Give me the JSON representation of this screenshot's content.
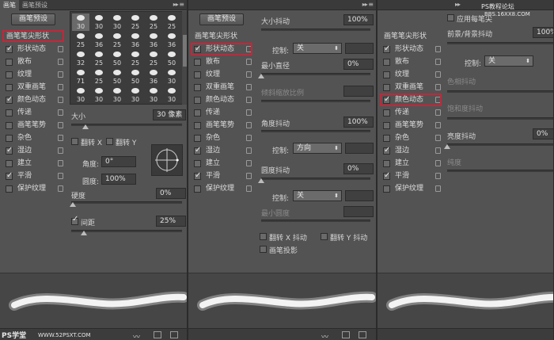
{
  "panel1": {
    "tabs": [
      "画笔",
      "画笔预设"
    ],
    "preset_button": "画笔预设",
    "sidebar": [
      {
        "label": "画笔笔尖形状",
        "checkbox": false,
        "checked": false,
        "lock": false
      },
      {
        "label": "形状动态",
        "checkbox": true,
        "checked": true,
        "lock": true
      },
      {
        "label": "散布",
        "checkbox": true,
        "checked": false,
        "lock": true
      },
      {
        "label": "纹理",
        "checkbox": true,
        "checked": false,
        "lock": true
      },
      {
        "label": "双重画笔",
        "checkbox": true,
        "checked": false,
        "lock": true
      },
      {
        "label": "颜色动态",
        "checkbox": true,
        "checked": true,
        "lock": true
      },
      {
        "label": "传递",
        "checkbox": true,
        "checked": false,
        "lock": true
      },
      {
        "label": "画笔笔势",
        "checkbox": true,
        "checked": false,
        "lock": true
      },
      {
        "label": "杂色",
        "checkbox": true,
        "checked": false,
        "lock": true
      },
      {
        "label": "湿边",
        "checkbox": true,
        "checked": true,
        "lock": true
      },
      {
        "label": "建立",
        "checkbox": true,
        "checked": false,
        "lock": true
      },
      {
        "label": "平滑",
        "checkbox": true,
        "checked": true,
        "lock": true
      },
      {
        "label": "保护纹理",
        "checkbox": true,
        "checked": false,
        "lock": true
      }
    ],
    "brush_tips": [
      [
        "30",
        "30",
        "30",
        "25",
        "25",
        "25"
      ],
      [
        "25",
        "36",
        "25",
        "36",
        "36",
        "36"
      ],
      [
        "32",
        "25",
        "50",
        "25",
        "25",
        "50"
      ],
      [
        "71",
        "25",
        "50",
        "50",
        "36",
        "30"
      ],
      [
        "30",
        "30",
        "30",
        "30",
        "30",
        "30"
      ]
    ],
    "size_label": "大小",
    "size_value": "30 像素",
    "flip_x": "翻转 X",
    "flip_y": "翻转 Y",
    "angle_label": "角度:",
    "angle_value": "0°",
    "roundness_label": "圆度:",
    "roundness_value": "100%",
    "hardness_label": "硬度",
    "hardness_value": "0%",
    "spacing_label": "间距",
    "spacing_value": "25%"
  },
  "panel2": {
    "preset_button": "画笔预设",
    "sidebar": [
      {
        "label": "画笔笔尖形状",
        "checkbox": false,
        "checked": false,
        "lock": false
      },
      {
        "label": "形状动态",
        "checkbox": true,
        "checked": true,
        "lock": true
      },
      {
        "label": "散布",
        "checkbox": true,
        "checked": false,
        "lock": true
      },
      {
        "label": "纹理",
        "checkbox": true,
        "checked": false,
        "lock": true
      },
      {
        "label": "双重画笔",
        "checkbox": true,
        "checked": false,
        "lock": true
      },
      {
        "label": "颜色动态",
        "checkbox": true,
        "checked": false,
        "lock": true
      },
      {
        "label": "传递",
        "checkbox": true,
        "checked": false,
        "lock": true
      },
      {
        "label": "画笔笔势",
        "checkbox": true,
        "checked": false,
        "lock": true
      },
      {
        "label": "杂色",
        "checkbox": true,
        "checked": false,
        "lock": true
      },
      {
        "label": "湿边",
        "checkbox": true,
        "checked": true,
        "lock": true
      },
      {
        "label": "建立",
        "checkbox": true,
        "checked": false,
        "lock": true
      },
      {
        "label": "平滑",
        "checkbox": true,
        "checked": true,
        "lock": true
      },
      {
        "label": "保护纹理",
        "checkbox": true,
        "checked": false,
        "lock": true
      }
    ],
    "size_jitter_label": "大小抖动",
    "size_jitter_value": "100%",
    "control_label": "控制:",
    "control1_value": "关",
    "min_diameter_label": "最小直径",
    "min_diameter_value": "0%",
    "tilt_scale_label": "倾斜缩放比例",
    "angle_jitter_label": "角度抖动",
    "angle_jitter_value": "100%",
    "control2_value": "方向",
    "roundness_jitter_label": "圆度抖动",
    "roundness_jitter_value": "0%",
    "control3_value": "关",
    "min_roundness_label": "最小圆度",
    "flip_x_jitter": "翻转 X 抖动",
    "flip_y_jitter": "翻转 Y 抖动",
    "brush_projection": "画笔投影"
  },
  "panel3": {
    "sidebar": [
      {
        "label": "画笔笔尖形状",
        "checkbox": false,
        "checked": false,
        "lock": false
      },
      {
        "label": "形状动态",
        "checkbox": true,
        "checked": true,
        "lock": true
      },
      {
        "label": "散布",
        "checkbox": true,
        "checked": false,
        "lock": true
      },
      {
        "label": "纹理",
        "checkbox": true,
        "checked": false,
        "lock": true
      },
      {
        "label": "双重画笔",
        "checkbox": true,
        "checked": false,
        "lock": true
      },
      {
        "label": "颜色动态",
        "checkbox": true,
        "checked": true,
        "lock": true
      },
      {
        "label": "传递",
        "checkbox": true,
        "checked": false,
        "lock": true
      },
      {
        "label": "画笔笔势",
        "checkbox": true,
        "checked": false,
        "lock": true
      },
      {
        "label": "杂色",
        "checkbox": true,
        "checked": false,
        "lock": true
      },
      {
        "label": "湿边",
        "checkbox": true,
        "checked": true,
        "lock": true
      },
      {
        "label": "建立",
        "checkbox": true,
        "checked": false,
        "lock": true
      },
      {
        "label": "平滑",
        "checkbox": true,
        "checked": true,
        "lock": true
      },
      {
        "label": "保护纹理",
        "checkbox": true,
        "checked": false,
        "lock": true
      }
    ],
    "apply_per_tip": "应用每笔尖",
    "fg_bg_jitter_label": "前景/背景抖动",
    "fg_bg_jitter_value": "100%",
    "control_label": "控制:",
    "control_value": "关",
    "hue_jitter_label": "色相抖动",
    "saturation_jitter_label": "饱和度抖动",
    "brightness_jitter_label": "亮度抖动",
    "brightness_jitter_value": "0%",
    "purity_label": "纯度"
  },
  "watermark_top": "PS教程论坛",
  "watermark_top_url": "BBS.16XX8.COM",
  "watermark_bottom": "PS学堂",
  "watermark_bottom_url": "WWW.52PSXT.COM",
  "colors": {
    "panel_bg": "#535353",
    "highlight": "#c2273b",
    "field_bg": "#404040"
  }
}
